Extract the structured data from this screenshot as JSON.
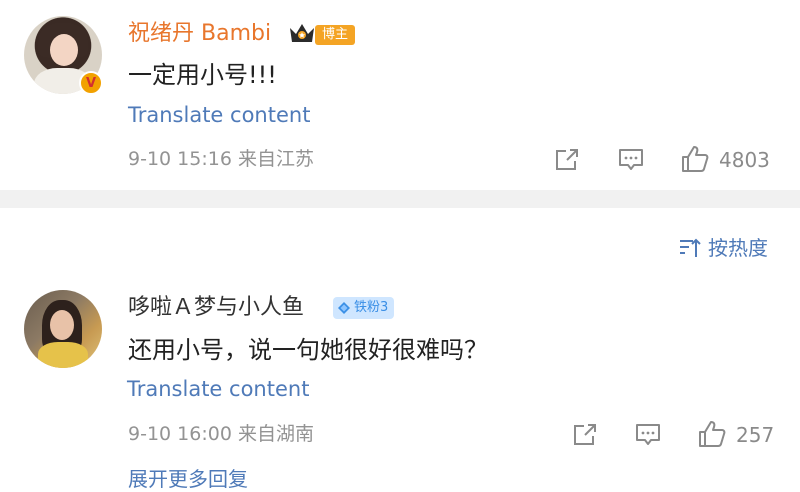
{
  "comments": [
    {
      "username": "祝绪丹 Bambi",
      "badge": "博主",
      "text": "一定用小号!!!",
      "translate": "Translate content",
      "meta": "9-10 15:16  来自江苏",
      "likes": "4803",
      "verified": "V"
    },
    {
      "username": "哆啦Ａ梦与小人鱼",
      "badge": "铁粉3",
      "text": "还用小号，说一句她很好很难吗？",
      "translate": "Translate content",
      "meta": "9-10 16:00  来自湖南",
      "likes": "257"
    }
  ],
  "sort_label": "按热度",
  "more_replies": "展开更多回复",
  "colors": {
    "accent_link": "#4f7ab8",
    "username_blogger": "#e8762c",
    "badge_boss": "#f4a424",
    "badge_fan_bg": "#cfe6ff",
    "divider": "#f1f1f1"
  },
  "icons": [
    "share-icon",
    "comment-icon",
    "like-icon",
    "sort-icon",
    "crown-icon",
    "diamond-icon"
  ]
}
